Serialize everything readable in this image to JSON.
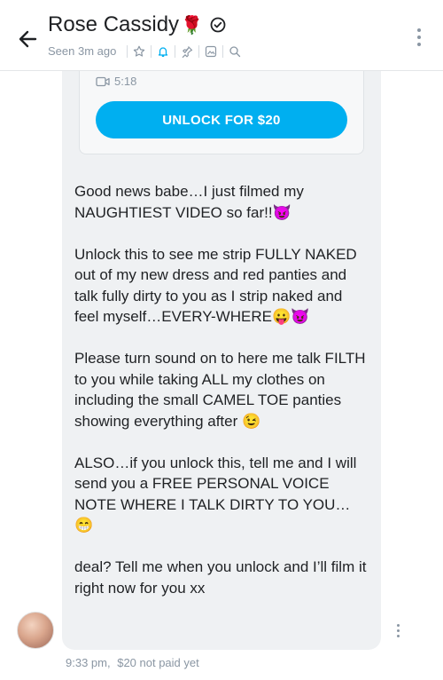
{
  "header": {
    "name": "Rose Cassidy",
    "name_emoji": "🌹",
    "status": "Seen 3m ago",
    "icons": [
      "back-arrow-icon",
      "verified-icon",
      "star-icon",
      "bell-icon",
      "pin-icon",
      "gallery-icon",
      "search-icon",
      "more-vertical-icon"
    ]
  },
  "message": {
    "media_duration": "5:18",
    "unlock_label": "UNLOCK FOR $20",
    "paragraphs": [
      "Good news babe…I just filmed my NAUGHTIEST VIDEO so far!!😈",
      "Unlock this to see me strip FULLY NAKED out of my new dress and red panties and talk fully dirty to you as I strip naked and feel myself…EVERY-WHERE😛😈",
      "Please turn sound on to here me talk FILTH to you while taking ALL my clothes on including the small CAMEL TOE panties showing everything after 😉",
      "ALSO…if you unlock this, tell me and I will send you a FREE PERSONAL VOICE NOTE WHERE I TALK DIRTY TO YOU… 😁",
      "deal? Tell me when you unlock and I’ll film it right now for you xx"
    ],
    "time": "9:33 pm,",
    "price_status": "$20 not paid yet"
  },
  "colors": {
    "accent": "#00aff0",
    "bubble": "#eff1f3",
    "muted": "#8a96a3"
  }
}
